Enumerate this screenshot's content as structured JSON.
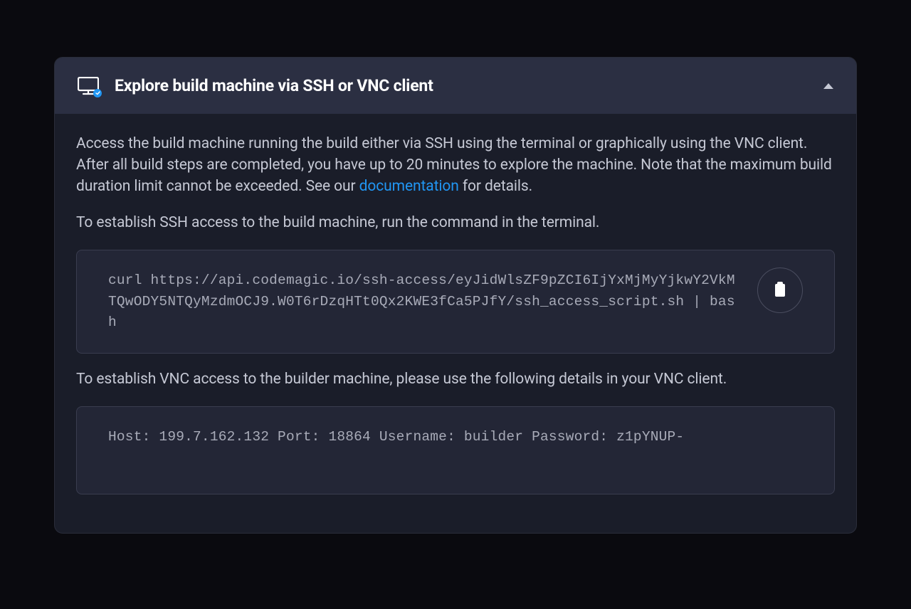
{
  "panel": {
    "title": "Explore build machine via SSH or VNC client",
    "description_part1": "Access the build machine running the build either via SSH using the terminal or graphically using the VNC client. After all build steps are completed, you have up to 20 minutes to explore the machine. Note that the maximum build duration limit cannot be exceeded. See our ",
    "documentation_link": "documentation",
    "description_part2": " for details.",
    "ssh_instruction": "To establish SSH access to the build machine, run the command in the terminal.",
    "ssh_command": "curl https://api.codemagic.io/ssh-access/eyJidWlsZF9pZCI6IjYxMjMyYjkwY2VkMTQwODY5NTQyMzdmOCJ9.W0T6rDzqHTt0Qx2KWE3fCa5PJfY/ssh_access_script.sh | bash",
    "vnc_instruction": "To establish VNC access to the builder machine, please use the following details in your VNC client.",
    "vnc_details": {
      "host_label": "Host:",
      "host_value": "199.7.162.132",
      "port_label": "Port:",
      "port_value": "18864",
      "username_label": "Username:",
      "username_value": "builder",
      "password_label": "Password:",
      "password_value": "z1pYNUP-"
    },
    "vnc_full_text": "Host: 199.7.162.132 Port: 18864 Username: builder Password: z1pYNUP-"
  }
}
